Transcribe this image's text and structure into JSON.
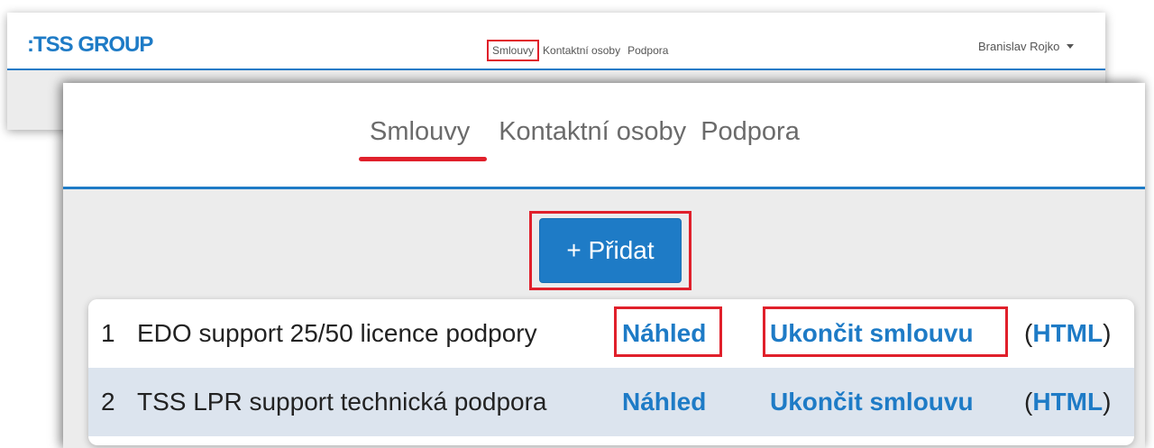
{
  "brand": {
    "logo_text": ":TSS GROUP"
  },
  "nav": {
    "items": [
      {
        "label": "Smlouvy"
      },
      {
        "label": "Kontaktní osoby"
      },
      {
        "label": "Podpora"
      }
    ],
    "active_index": 0
  },
  "user": {
    "name": "Branislav Rojko"
  },
  "actions": {
    "add_label": "+ Přidat"
  },
  "contracts": [
    {
      "number": "1",
      "name": "EDO support 25/50 licence podpory",
      "preview_label": "Náhled",
      "terminate_label": "Ukončit smlouvu",
      "html_open": "(",
      "html_label": "HTML",
      "html_close": ")"
    },
    {
      "number": "2",
      "name": "TSS LPR support technická podpora",
      "preview_label": "Náhled",
      "terminate_label": "Ukončit smlouvu",
      "html_open": "(",
      "html_label": "HTML",
      "html_close": ")"
    }
  ],
  "colors": {
    "brand": "#1e7bc6",
    "highlight": "#e0202b",
    "row_alt": "#dce4ee"
  }
}
